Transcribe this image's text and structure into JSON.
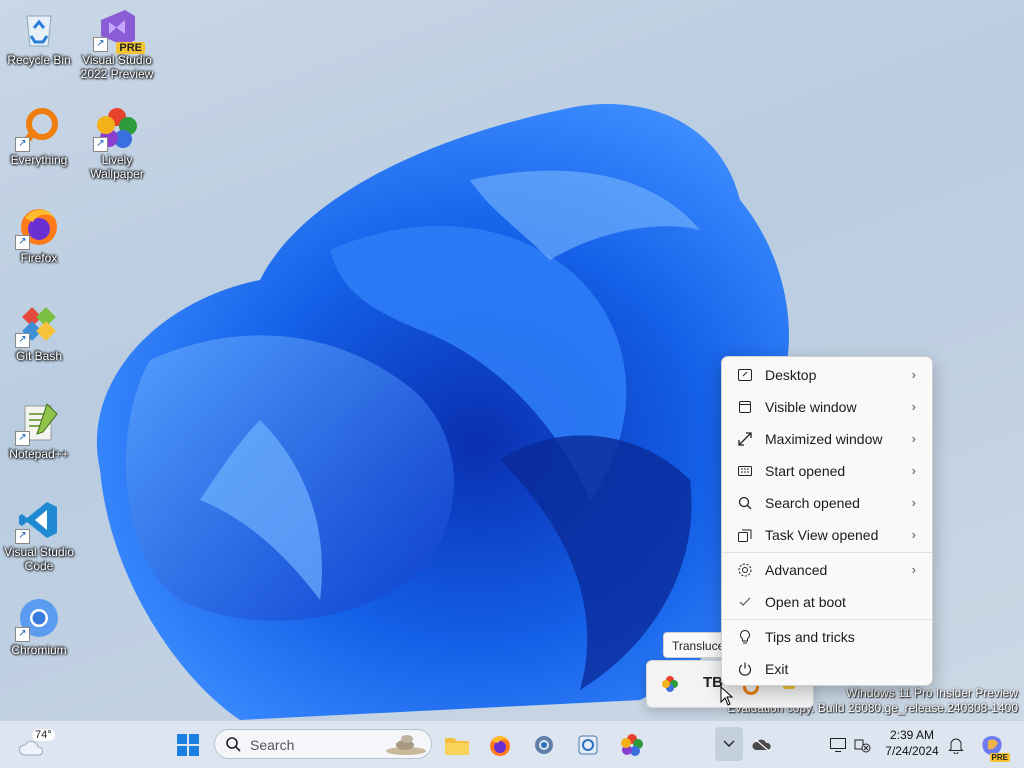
{
  "desktop": {
    "icons": [
      {
        "label": "Recycle Bin"
      },
      {
        "label": "Visual Studio 2022 Preview",
        "badge": "PRE"
      },
      {
        "label": "Everything"
      },
      {
        "label": "Lively Wallpaper"
      },
      {
        "label": "Firefox"
      },
      {
        "label": "Git Bash"
      },
      {
        "label": "Notepad++"
      },
      {
        "label": "Visual Studio Code"
      },
      {
        "label": "Chromium"
      }
    ]
  },
  "context_menu": {
    "items": [
      {
        "label": "Desktop",
        "icon": "desktop-icon",
        "submenu": true
      },
      {
        "label": "Visible window",
        "icon": "window-icon",
        "submenu": true
      },
      {
        "label": "Maximized window",
        "icon": "maximize-icon",
        "submenu": true
      },
      {
        "label": "Start opened",
        "icon": "start-icon",
        "submenu": true
      },
      {
        "label": "Search opened",
        "icon": "search-icon",
        "submenu": true
      },
      {
        "label": "Task View opened",
        "icon": "task-view-icon",
        "submenu": true
      },
      {
        "label": "Advanced",
        "icon": "gear-icon",
        "submenu": true
      },
      {
        "label": "Open at boot",
        "icon": "checkmark-icon",
        "checked": true
      },
      {
        "label": "Tips and tricks",
        "icon": "lightbulb-icon"
      },
      {
        "label": "Exit",
        "icon": "power-icon"
      }
    ]
  },
  "tooltip": {
    "text": "Transluce"
  },
  "watermark": {
    "line1": "Windows 11 Pro Insider Preview",
    "line2": "Evaluation copy. Build 26080.ge_release.240308-1400"
  },
  "taskbar": {
    "weather": "74°",
    "search_placeholder": "Search",
    "clock_time": "2:39 AM",
    "clock_date": "7/24/2024",
    "copilot_badge": "PRE"
  },
  "colors": {
    "accent": "#0067c0",
    "taskbar": "#dde6f0",
    "menu_bg": "#f9f9f9"
  }
}
